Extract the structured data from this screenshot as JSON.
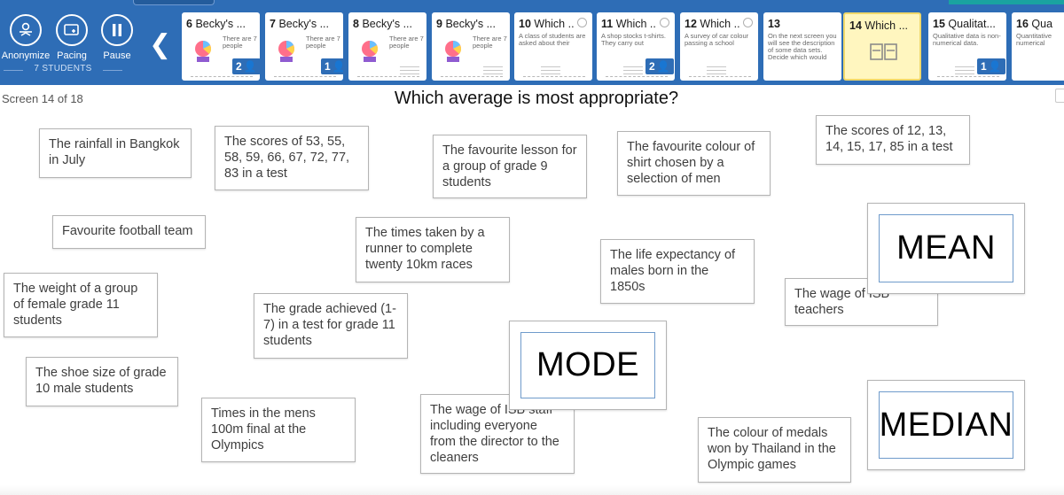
{
  "toolbar": {
    "anonymize_label": "Anonymize",
    "pacing_label": "Pacing",
    "pause_label": "Pause",
    "students_label": "7 STUDENTS",
    "prev_glyph": "❮"
  },
  "thumbnails": [
    {
      "num": "6",
      "title": "Becky's ...",
      "text": "There are 7 people",
      "badge": "2"
    },
    {
      "num": "7",
      "title": "Becky's ...",
      "text": "There are 7 people",
      "badge": "1"
    },
    {
      "num": "8",
      "title": "Becky's ...",
      "text": "There are 7 people",
      "badge": ""
    },
    {
      "num": "9",
      "title": "Becky's ...",
      "text": "There are 7 people",
      "badge": ""
    },
    {
      "num": "10",
      "title": "Which ..",
      "text": "A class of students are asked about their",
      "badge": ""
    },
    {
      "num": "11",
      "title": "Which ..",
      "text": "A shop stocks t-shirts. They carry out",
      "badge": "2"
    },
    {
      "num": "12",
      "title": "Which ..",
      "text": "A survey of car colour passing a school",
      "badge": ""
    },
    {
      "num": "13",
      "title": "",
      "text": "On the next screen you will see the description of some data sets. Decide which would",
      "badge": ""
    },
    {
      "num": "14",
      "title": "Which ...",
      "text": "",
      "badge": ""
    },
    {
      "num": "15",
      "title": "Qualitat...",
      "text": "Qualitative data is non-numerical data.",
      "badge": "1"
    },
    {
      "num": "16",
      "title": "Qua",
      "text": "Quantitative numerical",
      "badge": ""
    }
  ],
  "screen": {
    "counter": "Screen 14 of 18",
    "question": "Which average is most appropriate?"
  },
  "cards": [
    "The rainfall in Bangkok in July",
    "The scores of 53, 55, 58, 59, 66, 67, 72, 77, 83 in a test",
    "The favourite lesson for a group of grade 9 students",
    "The favourite colour of shirt chosen by a selection of men",
    "The scores of 12, 13, 14, 15, 17, 85 in a test",
    "Favourite football team",
    "The times taken by a runner to complete twenty 10km races",
    "The life expectancy of males born in the 1850s",
    "The wage of ISB teachers",
    "The weight of a group of female grade 11 students",
    "The grade achieved (1-7) in a test for grade 11 students",
    "The shoe size of grade 10 male students",
    "Times in the  mens 100m final at the Olympics",
    "The wage of ISB staff including everyone from the director to the cleaners",
    "The colour of medals won by Thailand in the Olympic games"
  ],
  "targets": {
    "mean": "MEAN",
    "mode": "MODE",
    "median": "MEDIAN"
  },
  "colors": {
    "topbar": "#2e6db6",
    "active_thumb": "#fff6bf",
    "target_border": "#6f9bcb"
  }
}
